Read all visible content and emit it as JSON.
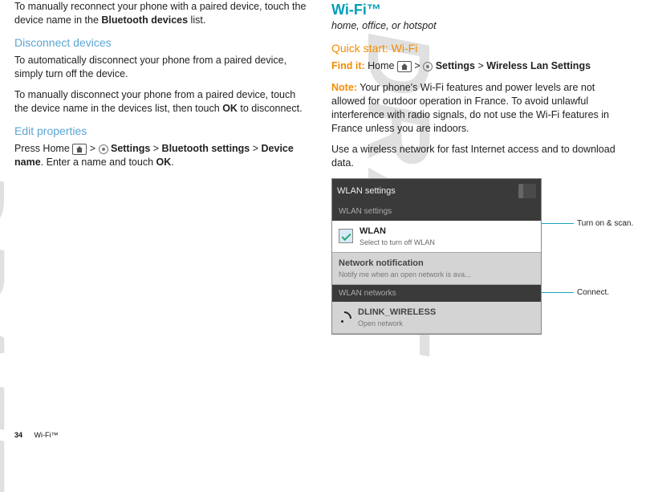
{
  "left": {
    "intro": "To manually reconnect your phone with a paired device, touch the device name in the ",
    "intro_bold": "Bluetooth devices",
    "intro_tail": " list.",
    "h_disconnect": "Disconnect devices",
    "p_disconnect1": "To automatically disconnect your phone from a paired device, simply turn off the device.",
    "p_disconnect2a": "To manually disconnect your phone from a paired device, touch the device name in the devices list, then touch ",
    "p_disconnect2b": "OK",
    "p_disconnect2c": " to disconnect.",
    "h_edit": "Edit properties",
    "edit_pre": "Press Home ",
    "gt": " > ",
    "settings": "Settings",
    "edit_mid": " > ",
    "bt_settings": "Bluetooth settings",
    "edit_mid2": " > ",
    "dev_name": "Device name",
    "edit_tail": ". Enter a name and touch ",
    "ok": "OK",
    "dot": "."
  },
  "right": {
    "h_wifi": "Wi-Fi™",
    "subtitle": "home, office, or hotspot",
    "h_quick": "Quick start: Wi-Fi",
    "find_it": "Find it:",
    "find_pre": " Home ",
    "settings": "Settings",
    "wlan": "Wireless Lan Settings",
    "note_lbl": "Note:",
    "note_body": " Your phone's Wi-Fi features and power levels are not allowed for outdoor operation in France. To avoid unlawful interference with radio signals, do not use the Wi-Fi features in France unless you are indoors.",
    "use_body": "Use a wireless network for fast Internet access and to download data."
  },
  "shot": {
    "title": "WLAN settings",
    "sec1": "WLAN settings",
    "row1_t": "WLAN",
    "row1_s": "Select to turn off WLAN",
    "row2_t": "Network notification",
    "row2_s": "Notify me when an open network is ava...",
    "sec2": "WLAN networks",
    "row3_t": "DLINK_WIRELESS",
    "row3_s": "Open network"
  },
  "callouts": {
    "c1": "Turn on & scan.",
    "c2": "Connect."
  },
  "footer": {
    "page": "34",
    "section": "Wi-Fi™"
  }
}
